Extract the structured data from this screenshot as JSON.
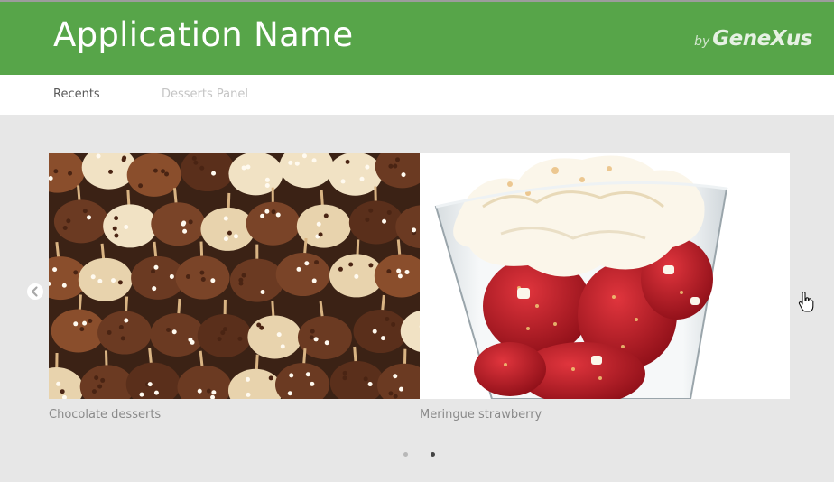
{
  "header": {
    "title": "Application Name",
    "brand_by": "by",
    "brand_name": "GeneXus",
    "color": "#57a549"
  },
  "tabs": [
    {
      "label": "Recents",
      "active": true
    },
    {
      "label": "Desserts Panel",
      "active": false
    }
  ],
  "carousel": {
    "items": [
      {
        "caption": "Chocolate desserts",
        "image": "chocolate-cake-pops-photo"
      },
      {
        "caption": "Meringue strawberry",
        "image": "strawberry-meringue-glass-photo"
      }
    ],
    "prev_icon": "chevron-left-icon",
    "pagination": {
      "count": 2,
      "active_index": 1
    }
  },
  "cursor_icon": "hand-pointer-icon"
}
